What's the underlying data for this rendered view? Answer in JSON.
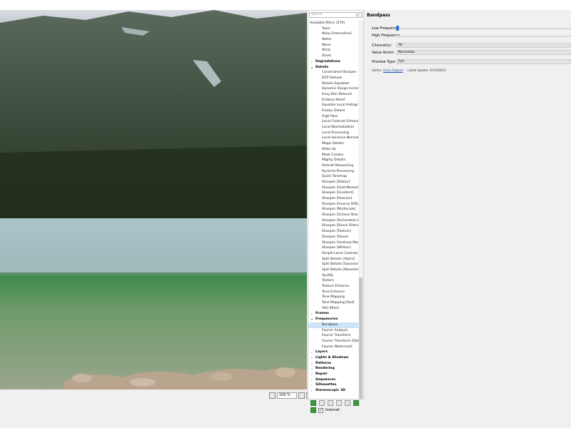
{
  "search": {
    "placeholder": "Search"
  },
  "filters": {
    "header": "Available filters (579)",
    "rows": [
      {
        "type": "item",
        "label": "Twist"
      },
      {
        "type": "item",
        "label": "Warp [Interactive]"
      },
      {
        "type": "item",
        "label": "Water"
      },
      {
        "type": "item",
        "label": "Wave"
      },
      {
        "type": "item",
        "label": "Wind"
      },
      {
        "type": "item",
        "label": "Zoom"
      },
      {
        "type": "cat",
        "label": "Degradations",
        "expanded": false
      },
      {
        "type": "cat",
        "label": "Details",
        "expanded": true
      },
      {
        "type": "item",
        "label": "Constrained Sharpen"
      },
      {
        "type": "item",
        "label": "DCP Dehaze"
      },
      {
        "type": "item",
        "label": "Details Equalizer"
      },
      {
        "type": "item",
        "label": "Dynamic Range Increase"
      },
      {
        "type": "item",
        "label": "Easy Skin Retouch"
      },
      {
        "type": "item",
        "label": "Emboss Relief"
      },
      {
        "type": "item",
        "label": "Equalize Local Histogram"
      },
      {
        "type": "item",
        "label": "Freaky Details"
      },
      {
        "type": "item",
        "label": "High Pass"
      },
      {
        "type": "item",
        "label": "Local Contrast Enhancement"
      },
      {
        "type": "item",
        "label": "Local Normalization"
      },
      {
        "type": "item",
        "label": "Local Processing"
      },
      {
        "type": "item",
        "label": "Local Variance Normalization"
      },
      {
        "type": "item",
        "label": "Magic Details"
      },
      {
        "type": "item",
        "label": "Make Up"
      },
      {
        "type": "item",
        "label": "Mask Creator"
      },
      {
        "type": "item",
        "label": "Mighty Details"
      },
      {
        "type": "item",
        "label": "Portrait Retouching"
      },
      {
        "type": "item",
        "label": "Pyramid Processing"
      },
      {
        "type": "item",
        "label": "Quick Tonemap"
      },
      {
        "type": "item",
        "label": "Sharpen [Deblur]"
      },
      {
        "type": "item",
        "label": "Sharpen [Gold-Meinel]"
      },
      {
        "type": "item",
        "label": "Sharpen [Gradient]"
      },
      {
        "type": "item",
        "label": "Sharpen [Hessian]"
      },
      {
        "type": "item",
        "label": "Sharpen [Inverse Diffusion]"
      },
      {
        "type": "item",
        "label": "Sharpen [Multiscale]"
      },
      {
        "type": "item",
        "label": "Sharpen [Octave Sharpening]"
      },
      {
        "type": "item",
        "label": "Sharpen [Richardson-Lucy]"
      },
      {
        "type": "item",
        "label": "Sharpen [Shock Filters]"
      },
      {
        "type": "item",
        "label": "Sharpen [Texture]"
      },
      {
        "type": "item",
        "label": "Sharpen [Tones]"
      },
      {
        "type": "item",
        "label": "Sharpen [Unsharp Mask]"
      },
      {
        "type": "item",
        "label": "Sharpen [Whiten]"
      },
      {
        "type": "item",
        "label": "Simple Local Contrast"
      },
      {
        "type": "item",
        "label": "Split Details [Alpha]"
      },
      {
        "type": "item",
        "label": "Split Details [Gaussian]"
      },
      {
        "type": "item",
        "label": "Split Details [Wavelets]"
      },
      {
        "type": "item",
        "label": "Spotify"
      },
      {
        "type": "item",
        "label": "Texture"
      },
      {
        "type": "item",
        "label": "Texture Enhance"
      },
      {
        "type": "item",
        "label": "Tone Enhance"
      },
      {
        "type": "item",
        "label": "Tone Mapping"
      },
      {
        "type": "item",
        "label": "Tone Mapping [fast]"
      },
      {
        "type": "item",
        "label": "YAG Effect"
      },
      {
        "type": "cat",
        "label": "Frames",
        "expanded": false
      },
      {
        "type": "cat",
        "label": "Frequencies",
        "expanded": true
      },
      {
        "type": "item",
        "label": "Bandpass",
        "selected": true
      },
      {
        "type": "item",
        "label": "Fourier Analysis"
      },
      {
        "type": "item",
        "label": "Fourier Transform"
      },
      {
        "type": "item",
        "label": "Fourier Transform [Old]"
      },
      {
        "type": "item",
        "label": "Fourier Watermark"
      },
      {
        "type": "cat",
        "label": "Layers",
        "expanded": false
      },
      {
        "type": "cat",
        "label": "Lights & Shadows",
        "expanded": false
      },
      {
        "type": "cat",
        "label": "Patterns",
        "expanded": false
      },
      {
        "type": "cat",
        "label": "Rendering",
        "expanded": false
      },
      {
        "type": "cat",
        "label": "Repair",
        "expanded": false
      },
      {
        "type": "cat",
        "label": "Sequences",
        "expanded": false
      },
      {
        "type": "cat",
        "label": "Silhouettes",
        "expanded": false
      },
      {
        "type": "cat",
        "label": "Stereoscopic 3D",
        "expanded": false
      }
    ]
  },
  "zoom": {
    "value": "100 %"
  },
  "bottom": {
    "internet_label": "Internet",
    "internet_checked": true
  },
  "params": {
    "title": "Bandpass",
    "low_frequency_label": "Low Frequency",
    "low_frequency_value": 0,
    "high_frequency_label": "High Frequency",
    "channels_label": "Channel(s)",
    "channels_value": "All",
    "value_action_label": "Value Action",
    "value_action_value": "Normalize",
    "preview_type_label": "Preview Type",
    "preview_type_value": "Full",
    "author_label": "Author:",
    "author_name": "Garry Osgood",
    "updated_label": "Latest Update:",
    "updated_value": "2015/09/12"
  },
  "colors": {
    "accent": "#2a6fc9",
    "selected": "#cde3f7",
    "green_icon": "#3b9b3b"
  }
}
